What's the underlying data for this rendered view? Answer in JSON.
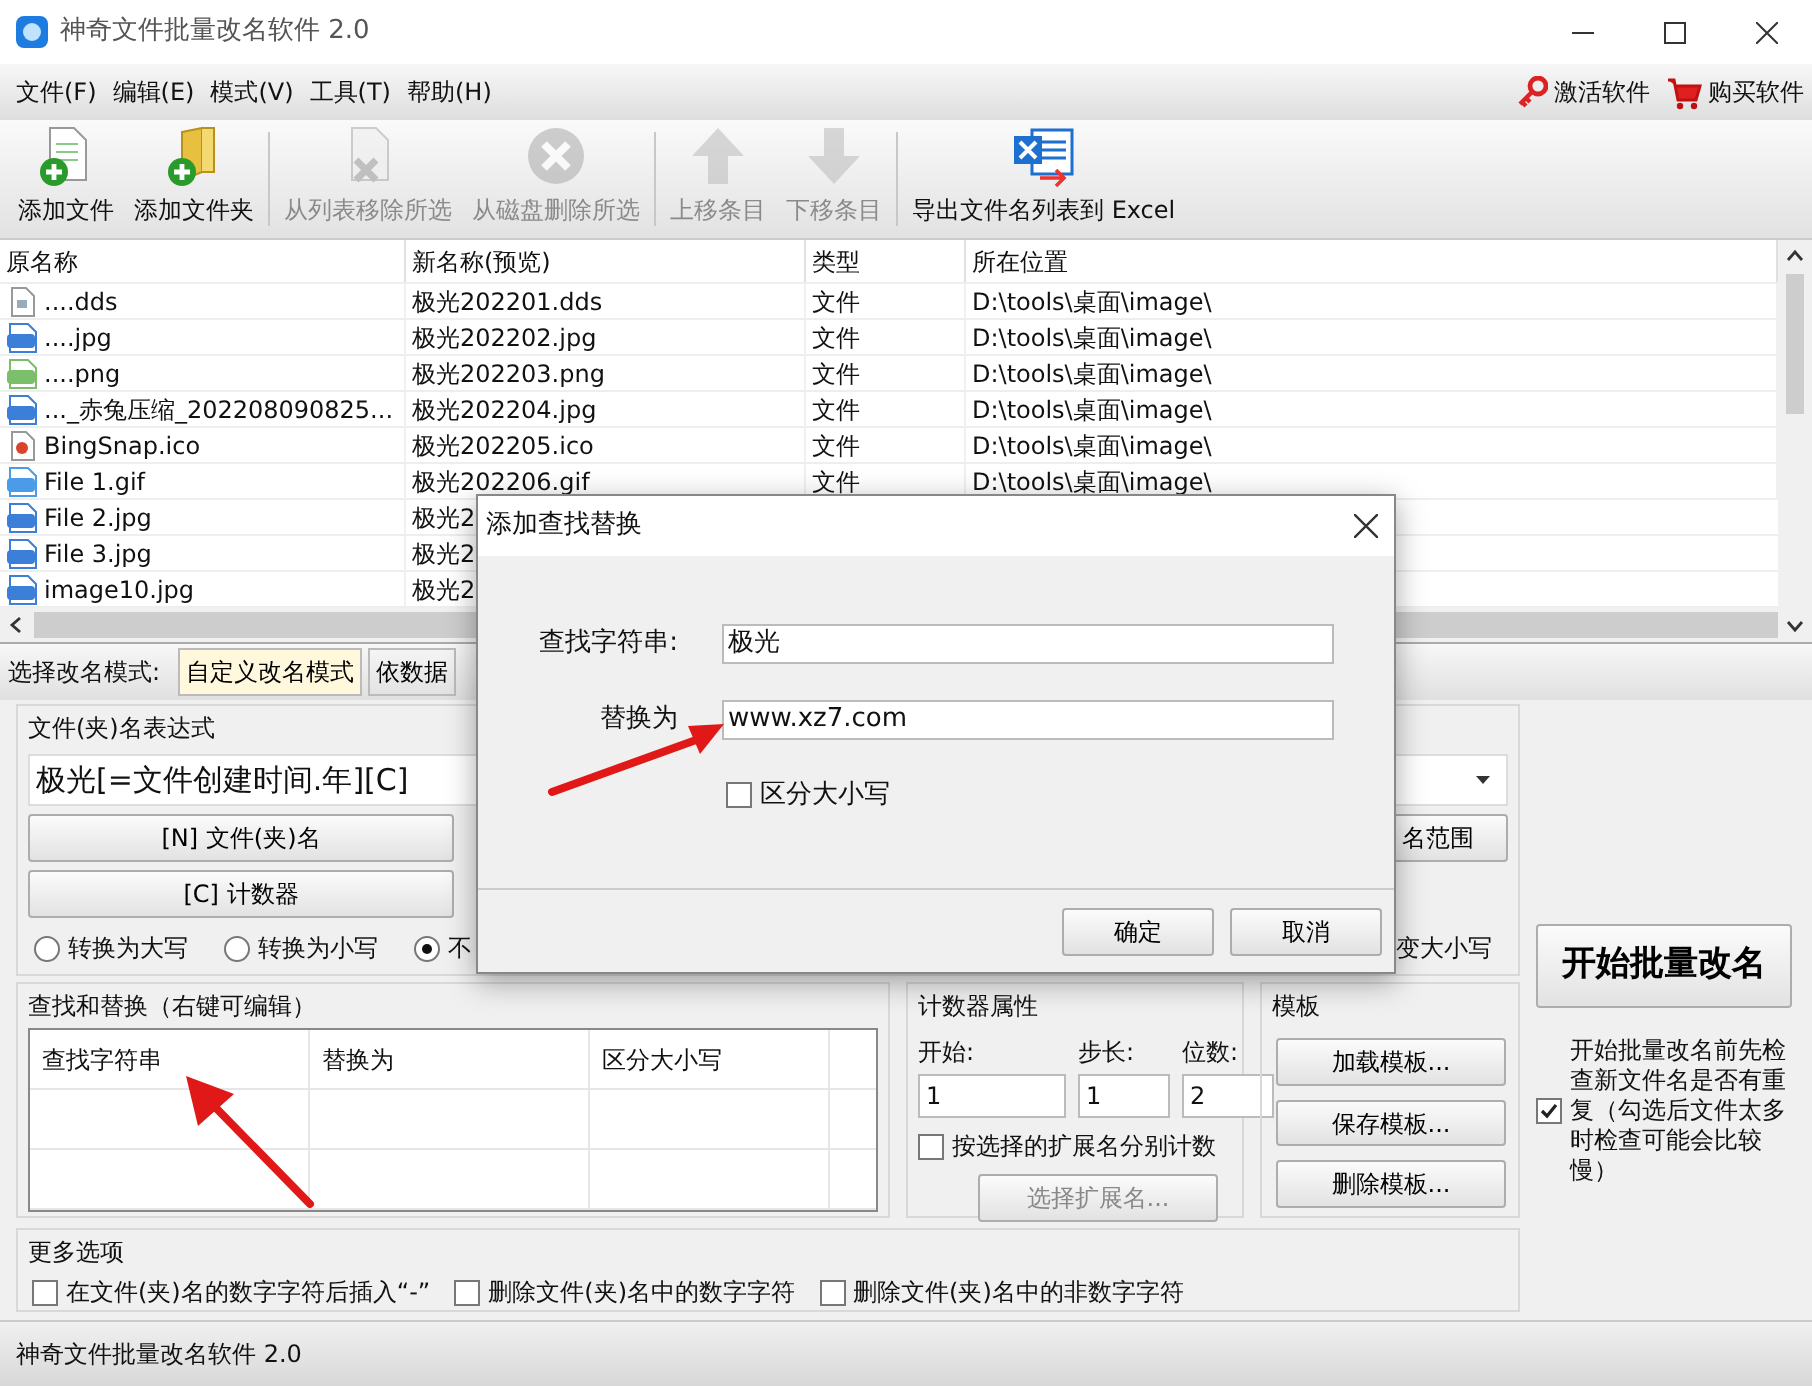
{
  "window": {
    "title": "神奇文件批量改名软件 2.0"
  },
  "menu": [
    "文件(F)",
    "编辑(E)",
    "模式(V)",
    "工具(T)",
    "帮助(H)"
  ],
  "menu_right": [
    "激活软件",
    "购买软件"
  ],
  "toolbar": [
    {
      "label": "添加文件",
      "disabled": false
    },
    {
      "label": "添加文件夹",
      "disabled": false
    },
    {
      "label": "从列表移除所选",
      "disabled": true
    },
    {
      "label": "从磁盘删除所选",
      "disabled": true
    },
    {
      "label": "上移条目",
      "disabled": true
    },
    {
      "label": "下移条目",
      "disabled": true
    },
    {
      "label": "导出文件名列表到 Excel",
      "disabled": false
    }
  ],
  "file_table": {
    "columns": [
      "原名称",
      "新名称(预览)",
      "类型",
      "所在位置"
    ],
    "rows": [
      {
        "kind": "dds",
        "cells": [
          "....dds",
          "极光202201.dds",
          "文件",
          "D:\\tools\\桌面\\image\\"
        ]
      },
      {
        "kind": "jpg",
        "cells": [
          "....jpg",
          "极光202202.jpg",
          "文件",
          "D:\\tools\\桌面\\image\\"
        ]
      },
      {
        "kind": "png",
        "cells": [
          "....png",
          "极光202203.png",
          "文件",
          "D:\\tools\\桌面\\image\\"
        ]
      },
      {
        "kind": "jpg",
        "cells": [
          "..._赤兔压缩_202208090825...",
          "极光202204.jpg",
          "文件",
          "D:\\tools\\桌面\\image\\"
        ]
      },
      {
        "kind": "ico",
        "cells": [
          "BingSnap.ico",
          "极光202205.ico",
          "文件",
          "D:\\tools\\桌面\\image\\"
        ]
      },
      {
        "kind": "gif",
        "cells": [
          "File 1.gif",
          "极光202206.gif",
          "文件",
          "D:\\tools\\桌面\\image\\"
        ]
      },
      {
        "kind": "jpg",
        "cells": [
          "File 2.jpg",
          "极光2"
        ]
      },
      {
        "kind": "jpg",
        "cells": [
          "File 3.jpg",
          "极光2"
        ]
      },
      {
        "kind": "jpg",
        "cells": [
          "image10.jpg",
          "极光2"
        ]
      }
    ]
  },
  "mode_bar": {
    "label": "选择改名模式:",
    "modes": [
      {
        "label": "自定义改名模式",
        "selected": true
      },
      {
        "label": "依数据",
        "selected": false
      }
    ]
  },
  "expression": {
    "title": "文件(夹)名表达式",
    "value": "极光[=文件创建时间.年][C]",
    "buttons": [
      "[N] 文件(夹)名",
      "[C] 计数器"
    ],
    "cut_button": "名范围",
    "case_options": [
      {
        "label": "转换为大写",
        "selected": false
      },
      {
        "label": "转换为小写",
        "selected": false
      },
      {
        "label": "不",
        "selected": true
      }
    ],
    "cut_case_option": "变大小写"
  },
  "find_replace": {
    "title": "查找和替换（右键可编辑）",
    "columns": [
      "查找字符串",
      "替换为",
      "区分大小写"
    ]
  },
  "counter": {
    "title": "计数器属性",
    "fields": [
      {
        "label": "开始:",
        "value": "1"
      },
      {
        "label": "步长:",
        "value": "1"
      },
      {
        "label": "位数:",
        "value": "2"
      }
    ],
    "per_extension": {
      "label": "按选择的扩展名分别计数",
      "checked": false
    },
    "button": {
      "label": "选择扩展名...",
      "disabled": true
    }
  },
  "templates": {
    "title": "模板",
    "buttons": [
      "加载模板...",
      "保存模板...",
      "删除模板..."
    ]
  },
  "start_button": "开始批量改名",
  "check_duplicates": {
    "label": "开始批量改名前先检查新文件名是否有重复（勾选后文件太多时检查可能会比较慢）",
    "checked": true
  },
  "more_options": {
    "title": "更多选项",
    "options": [
      {
        "label": "在文件(夹)名的数字字符后插入“-”",
        "checked": false
      },
      {
        "label": "删除文件(夹)名中的数字字符",
        "checked": false
      },
      {
        "label": "删除文件(夹)名中的非数字字符",
        "checked": false
      }
    ]
  },
  "status_bar": "神奇文件批量改名软件 2.0",
  "dialog": {
    "title": "添加查找替换",
    "find": {
      "label": "查找字符串:",
      "value": "极光"
    },
    "replace": {
      "label": "替换为",
      "value": "www.xz7.com"
    },
    "match_case": {
      "label": "区分大小写",
      "checked": false
    },
    "buttons": [
      "确定",
      "取消"
    ]
  }
}
